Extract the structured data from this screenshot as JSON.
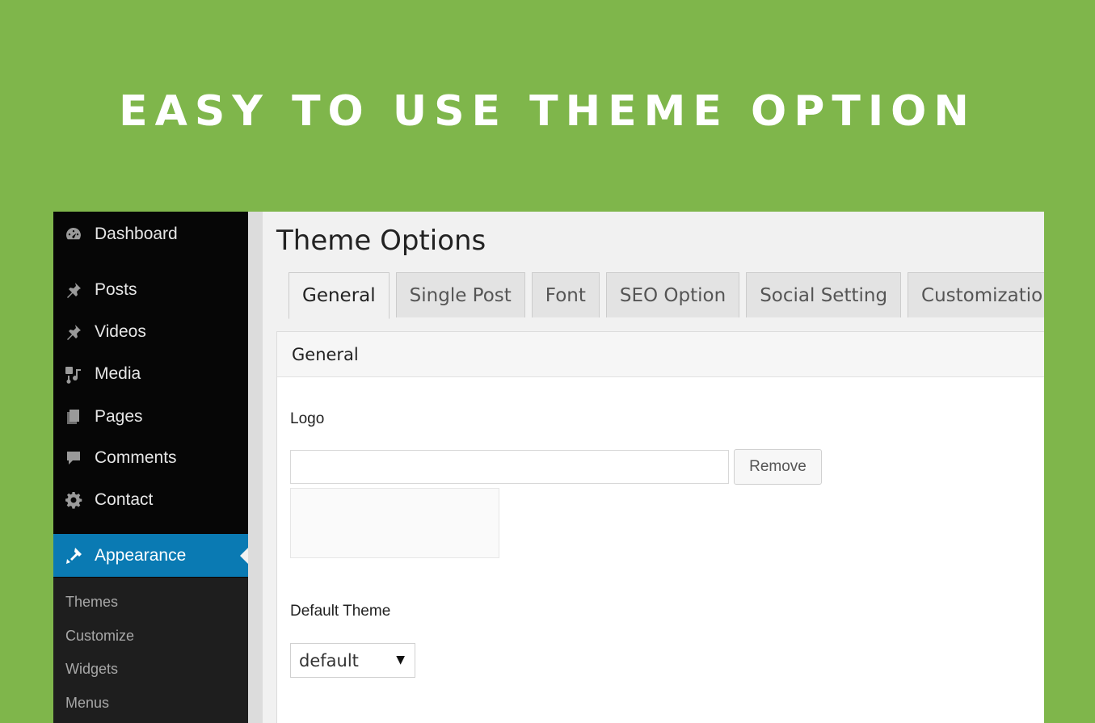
{
  "banner": {
    "title": "EASY TO USE THEME OPTION"
  },
  "sidebar": {
    "items": [
      {
        "label": "Dashboard",
        "icon": "dashboard-icon"
      },
      {
        "label": "Posts",
        "icon": "pin-icon"
      },
      {
        "label": "Videos",
        "icon": "pin-icon"
      },
      {
        "label": "Media",
        "icon": "media-icon"
      },
      {
        "label": "Pages",
        "icon": "pages-icon"
      },
      {
        "label": "Comments",
        "icon": "comment-icon"
      },
      {
        "label": "Contact",
        "icon": "gear-icon"
      },
      {
        "label": "Appearance",
        "icon": "brush-icon",
        "active": true
      }
    ],
    "submenu": [
      "Themes",
      "Customize",
      "Widgets",
      "Menus"
    ]
  },
  "main": {
    "title": "Theme Options",
    "tabs": [
      {
        "label": "General",
        "active": true
      },
      {
        "label": "Single Post"
      },
      {
        "label": "Font"
      },
      {
        "label": "SEO Option"
      },
      {
        "label": "Social Setting"
      },
      {
        "label": "Customization"
      }
    ],
    "panel": {
      "header": "General",
      "logo_label": "Logo",
      "logo_value": "",
      "remove_label": "Remove",
      "default_theme_label": "Default Theme",
      "default_theme_value": "default"
    }
  },
  "colors": {
    "background": "#7fb64b",
    "sidebar": "#060606",
    "active_accent": "#0a7ab3"
  }
}
